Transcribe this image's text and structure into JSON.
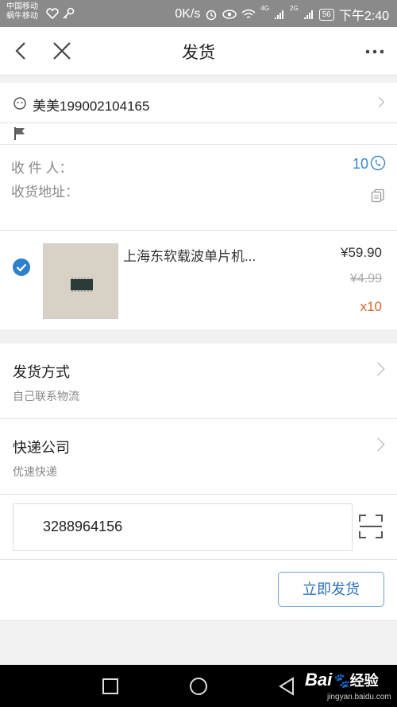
{
  "status": {
    "carrier1": "中国移动",
    "carrier2": "蜗牛移动",
    "speed": "0K/s",
    "net1": "4G",
    "net2": "2G",
    "battery": "56",
    "time": "下午2:40"
  },
  "nav": {
    "title": "发货"
  },
  "buyer": {
    "name": "美美199002104165"
  },
  "receiver": {
    "name_label": "收 件 人：",
    "address_label": "收货地址：",
    "phone_partial": "10"
  },
  "product": {
    "title": "上海东软载波单片机...",
    "price": "¥59.90",
    "original_price": "¥4.99",
    "quantity": "x10"
  },
  "shipping_method": {
    "label": "发货方式",
    "value": "自己联系物流"
  },
  "courier": {
    "label": "快递公司",
    "value": "优速快递"
  },
  "tracking": {
    "number": "3288964156"
  },
  "actions": {
    "ship_now": "立即发货"
  },
  "watermark": {
    "brand": "Bai",
    "sub": "经验",
    "url": "jingyan.baidu.com"
  }
}
